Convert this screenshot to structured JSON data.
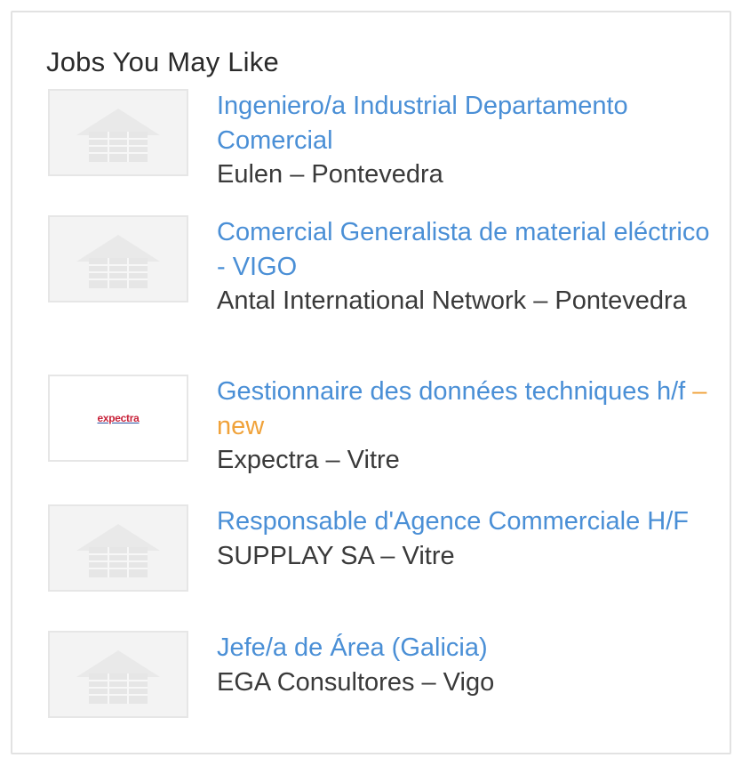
{
  "widget": {
    "title": "Jobs You May Like",
    "jobs": [
      {
        "title": "Ingeniero/a Industrial Departamento Comercial",
        "company_location": "Eulen – Pontevedra",
        "logo_icon": "building-icon"
      },
      {
        "title": "Comercial Generalista de material eléctrico - VIGO",
        "company_location": "Antal International Network – Pontevedra",
        "logo_icon": "building-icon"
      },
      {
        "title": "Gestionnaire des données techniques h/f",
        "badge": " – new",
        "company_location": "Expectra – Vitre",
        "logo_icon": "expectra-logo",
        "logo_text": "expectra"
      },
      {
        "title": "Responsable d'Agence Commerciale H/F",
        "company_location": "SUPPLAY SA – Vitre",
        "logo_icon": "building-icon"
      },
      {
        "title": "Jefe/a de Área (Galicia)",
        "company_location": "EGA Consultores – Vigo",
        "logo_icon": "building-icon"
      }
    ],
    "colors": {
      "link": "#4a8fd6",
      "new_badge": "#f0a23a",
      "text": "#333333",
      "border": "#e2e2e2"
    }
  }
}
